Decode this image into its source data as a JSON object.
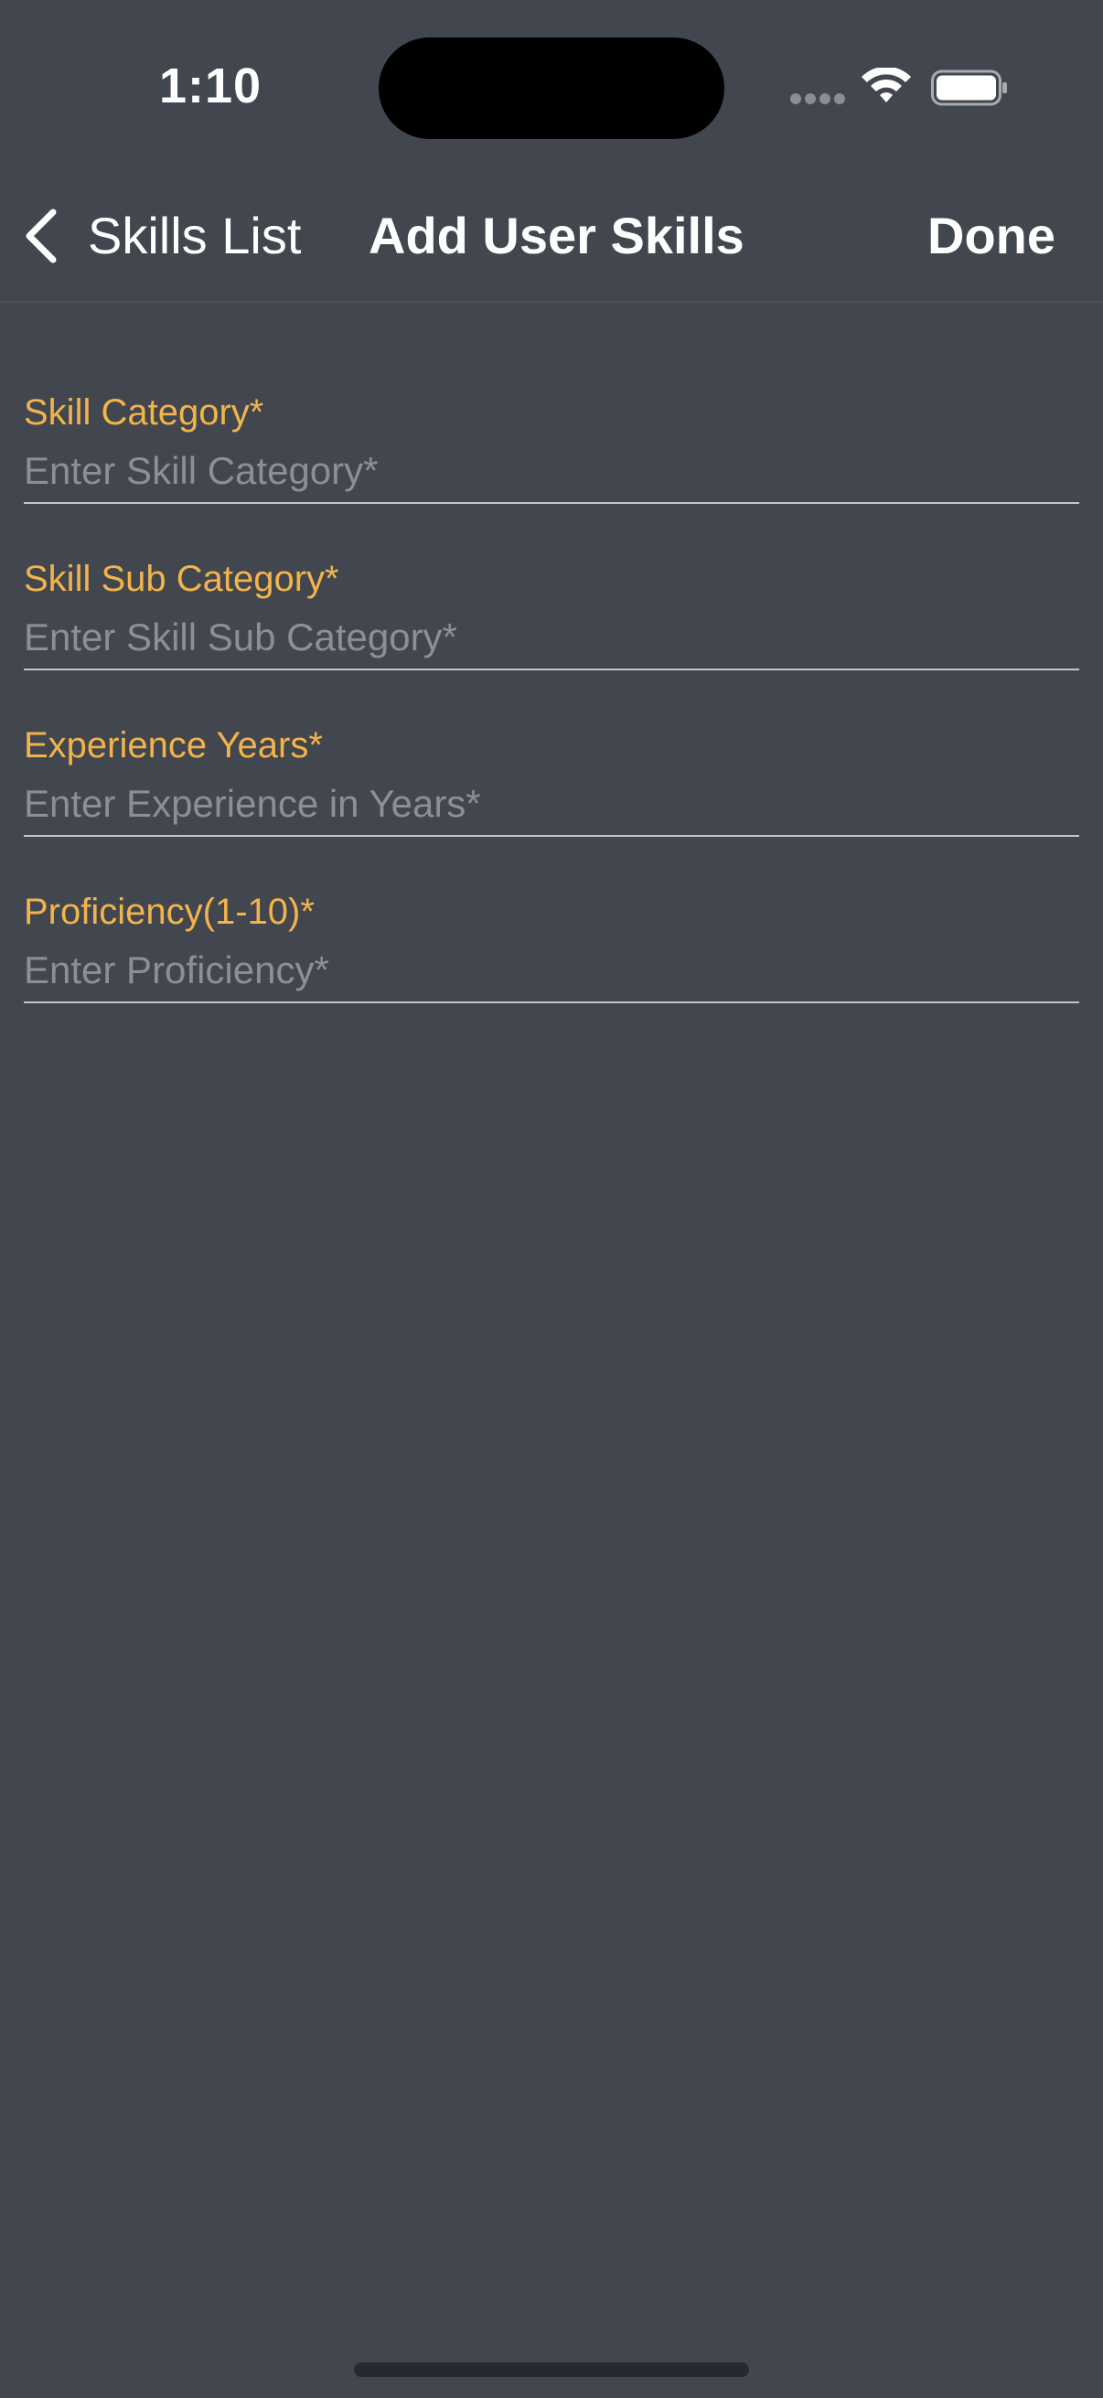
{
  "status_bar": {
    "time": "1:10"
  },
  "nav": {
    "back_label": "Skills List",
    "title": "Add User Skills",
    "done_label": "Done"
  },
  "form": {
    "fields": [
      {
        "label": "Skill Category*",
        "placeholder": "Enter Skill Category*",
        "value": ""
      },
      {
        "label": "Skill Sub Category*",
        "placeholder": "Enter Skill Sub Category*",
        "value": ""
      },
      {
        "label": "Experience Years*",
        "placeholder": "Enter Experience in Years*",
        "value": ""
      },
      {
        "label": "Proficiency(1-10)*",
        "placeholder": "Enter Proficiency*",
        "value": ""
      }
    ]
  },
  "colors": {
    "background": "#42464e",
    "label_accent": "#f2b44a",
    "placeholder": "#8c8f95",
    "underline": "#c4c6ca"
  },
  "icons": {
    "back": "chevron-left-icon",
    "wifi": "wifi-icon",
    "battery": "battery-icon",
    "cellular": "cellular-signal-icon"
  }
}
